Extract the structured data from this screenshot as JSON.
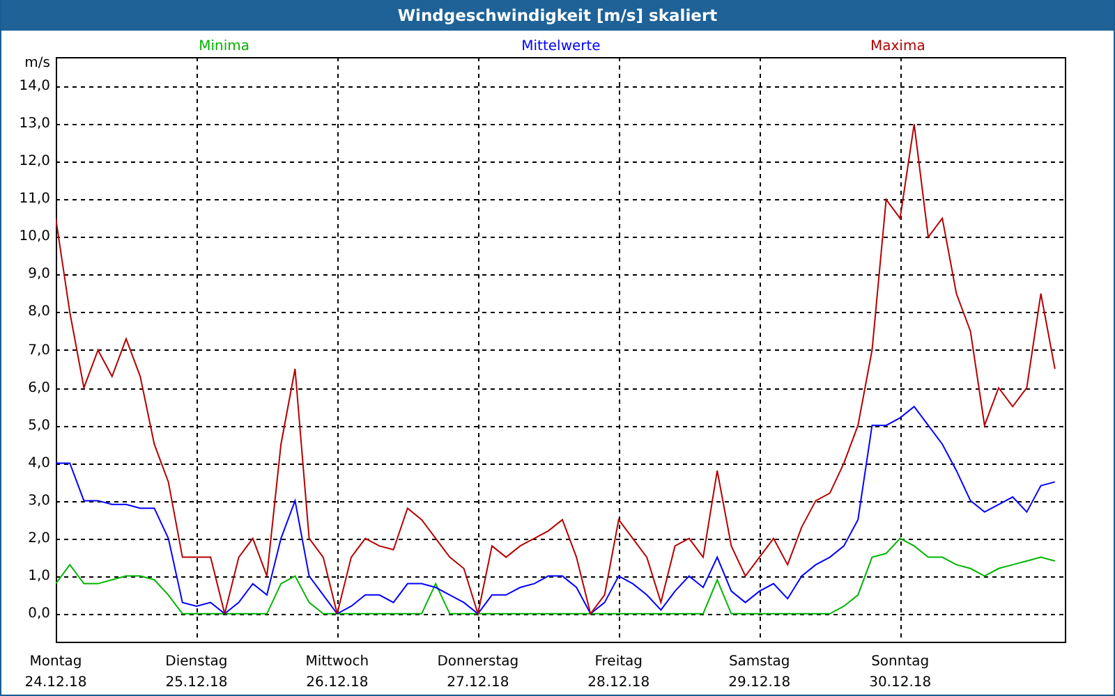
{
  "window": {
    "title": "Windgeschwindigkeit [m/s] skaliert"
  },
  "chart": {
    "chart_data": {
      "type": "line",
      "ylabel": "m/s",
      "categories": [
        "Montag 24.12.18",
        null,
        null,
        null,
        null,
        null,
        null,
        null,
        null,
        null,
        "Dienstag 25.12.18",
        null,
        null,
        null,
        null,
        null,
        null,
        null,
        null,
        null,
        "Mittwoch 26.12.18",
        null,
        null,
        null,
        null,
        null,
        null,
        null,
        null,
        null,
        "Donnerstag 27.12.18",
        null,
        null,
        null,
        null,
        null,
        null,
        null,
        null,
        null,
        "Freitag 28.12.18",
        null,
        null,
        null,
        null,
        null,
        null,
        null,
        null,
        null,
        "Samstag 29.12.18",
        null,
        null,
        null,
        null,
        null,
        null,
        null,
        null,
        null,
        "Sonntag 30.12.18",
        null,
        null,
        null,
        null,
        null,
        null,
        null,
        null,
        null,
        null,
        null
      ],
      "series": [
        {
          "name": "Minima",
          "color": "#00b400",
          "values": [
            0.8,
            1.3,
            0.8,
            0.8,
            0.9,
            1.0,
            1.0,
            0.9,
            0.5,
            0,
            0,
            0,
            0,
            0,
            0,
            0,
            0.8,
            1.0,
            0.3,
            0,
            0,
            0,
            0,
            0,
            0,
            0,
            0,
            0.8,
            0,
            0,
            0,
            0,
            0,
            0,
            0,
            0,
            0,
            0,
            0,
            0,
            0,
            0,
            0,
            0,
            0,
            0,
            0,
            0.9,
            0,
            0,
            0,
            0,
            0,
            0,
            0,
            0,
            0.2,
            0.5,
            1.5,
            1.6,
            2.0,
            1.8,
            1.5,
            1.5,
            1.3,
            1.2,
            1.0,
            1.2,
            1.3,
            1.4,
            1.5,
            1.4
          ]
        },
        {
          "name": "Mittelwerte",
          "color": "#0000ff",
          "values": [
            4.0,
            4.0,
            3.0,
            3.0,
            2.9,
            2.9,
            2.8,
            2.8,
            2.0,
            0.3,
            0.2,
            0.3,
            0.0,
            0.3,
            0.8,
            0.5,
            2.0,
            3.0,
            1.0,
            0.5,
            0.0,
            0.2,
            0.5,
            0.5,
            0.3,
            0.8,
            0.8,
            0.7,
            0.5,
            0.3,
            0.0,
            0.5,
            0.5,
            0.7,
            0.8,
            1.0,
            1.0,
            0.7,
            0.0,
            0.3,
            1.0,
            0.8,
            0.5,
            0.1,
            0.6,
            1.0,
            0.7,
            1.5,
            0.6,
            0.3,
            0.6,
            0.8,
            0.4,
            1.0,
            1.3,
            1.5,
            1.8,
            2.5,
            5.0,
            5.0,
            5.2,
            5.5,
            5.0,
            4.5,
            3.8,
            3.0,
            2.7,
            2.9,
            3.1,
            2.7,
            3.4,
            3.5
          ]
        },
        {
          "name": "Maxima",
          "color": "#b40000",
          "values": [
            10.5,
            8.0,
            6.0,
            7.0,
            6.3,
            7.3,
            6.3,
            4.5,
            3.5,
            1.5,
            1.5,
            1.5,
            0.0,
            1.5,
            2.0,
            1.0,
            4.5,
            6.5,
            2.0,
            1.5,
            0,
            1.5,
            2.0,
            1.8,
            1.7,
            2.8,
            2.5,
            2.0,
            1.5,
            1.2,
            0,
            1.8,
            1.5,
            1.8,
            2.0,
            2.2,
            2.5,
            1.5,
            0,
            0.5,
            2.5,
            2.0,
            1.5,
            0.3,
            1.8,
            2.0,
            1.5,
            3.8,
            1.8,
            1.0,
            1.5,
            2.0,
            1.3,
            2.3,
            3.0,
            3.2,
            4.0,
            5.0,
            7.0,
            11.0,
            10.5,
            13.0,
            10.0,
            10.5,
            8.5,
            7.5,
            5.0,
            6.0,
            5.5,
            6.0,
            8.5,
            6.5
          ]
        }
      ],
      "ylim": [
        -0.78,
        14.78
      ],
      "grid": true,
      "yticks": [
        {
          "value": 0,
          "label": "0,0"
        },
        {
          "value": 1,
          "label": "1,0"
        },
        {
          "value": 2,
          "label": "2,0"
        },
        {
          "value": 3,
          "label": "3,0"
        },
        {
          "value": 4,
          "label": "4,0"
        },
        {
          "value": 5,
          "label": "5,0"
        },
        {
          "value": 6,
          "label": "6,0"
        },
        {
          "value": 7,
          "label": "7,0"
        },
        {
          "value": 8,
          "label": "8,0"
        },
        {
          "value": 9,
          "label": "9,0"
        },
        {
          "value": 10,
          "label": "10,0"
        },
        {
          "value": 11,
          "label": "11,0"
        },
        {
          "value": 12,
          "label": "12,0"
        },
        {
          "value": 13,
          "label": "13,0"
        },
        {
          "value": 14,
          "label": "14,0"
        }
      ]
    }
  }
}
